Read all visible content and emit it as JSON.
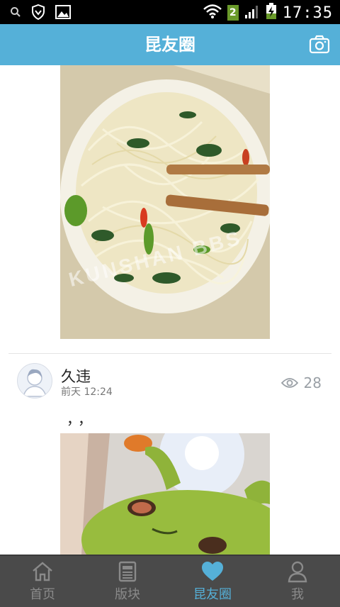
{
  "status_bar": {
    "sim_slot": "2",
    "time": "17:35",
    "icons": [
      "search-icon",
      "shield-icon",
      "image-icon",
      "wifi-icon",
      "signal-icon",
      "battery-charging-icon"
    ]
  },
  "header": {
    "title": "昆友圈",
    "right_icon": "camera-icon"
  },
  "feed": {
    "post": {
      "username": "久违",
      "time": "前天 12:24",
      "views": "28",
      "text": "，，"
    },
    "watermark": "KUNSHAN BBS"
  },
  "tabs": [
    {
      "label": "首页",
      "icon": "home-icon"
    },
    {
      "label": "版块",
      "icon": "boards-icon"
    },
    {
      "label": "昆友圈",
      "icon": "heart-icon",
      "active": true
    },
    {
      "label": "我",
      "icon": "person-icon"
    }
  ],
  "colors": {
    "header": "#55b0d8",
    "tabbar": "#4a4a4a",
    "active_tab": "#55b0d8"
  }
}
